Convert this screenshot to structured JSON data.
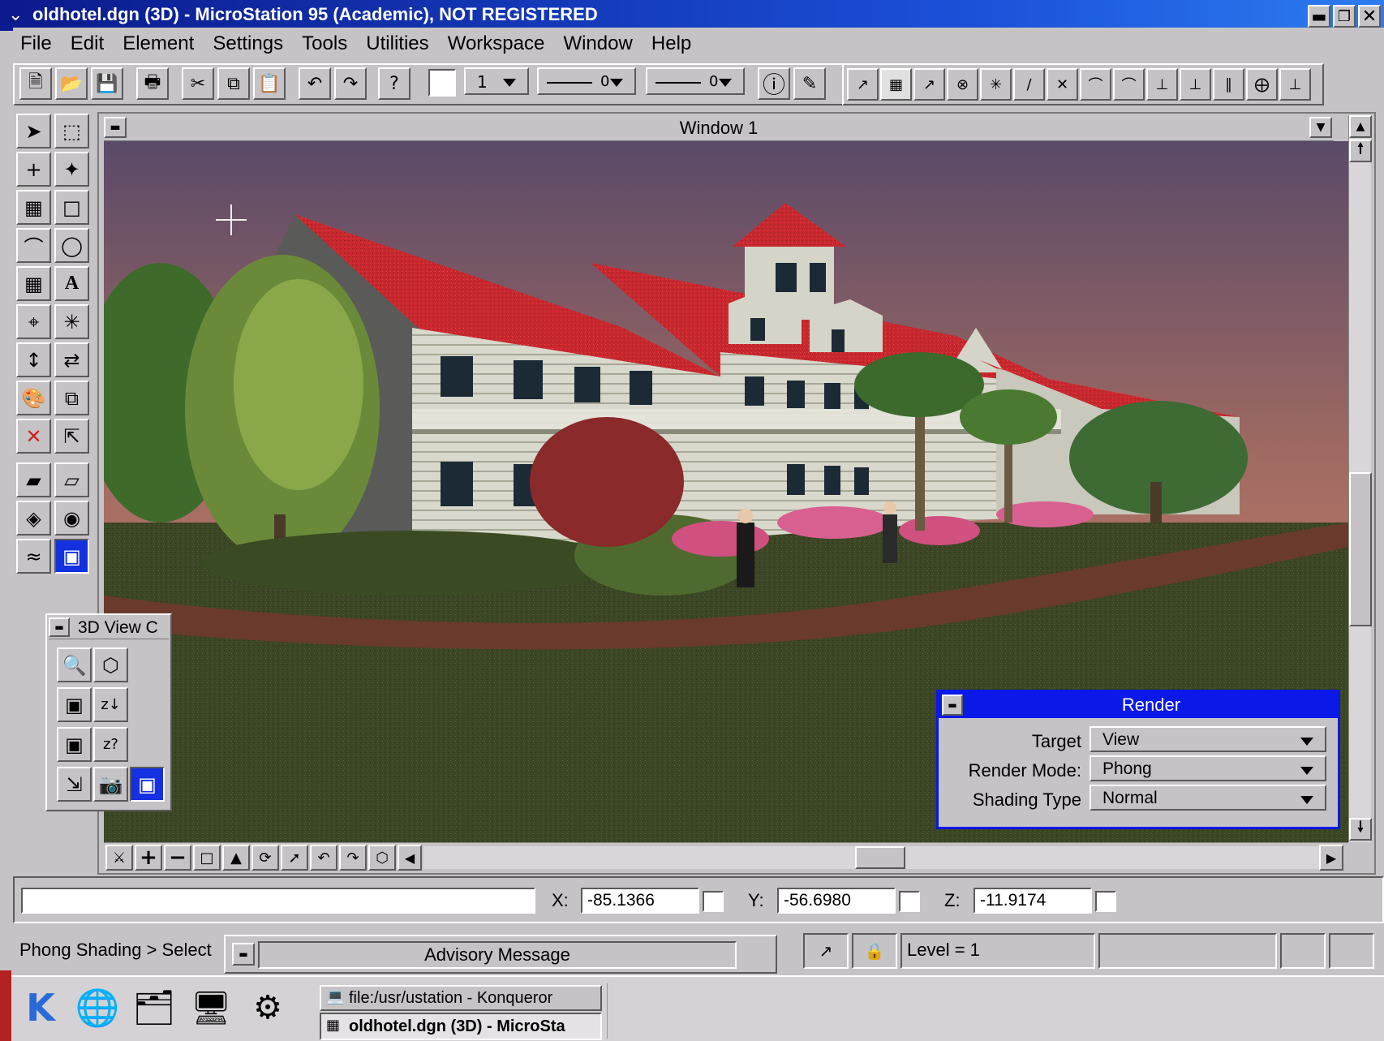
{
  "window": {
    "title": "oldhotel.dgn (3D) - MicroStation 95 (Academic), NOT REGISTERED",
    "controls": [
      "minimize-icon",
      "maximize-icon",
      "close-icon"
    ]
  },
  "menu": [
    "File",
    "Edit",
    "Element",
    "Settings",
    "Tools",
    "Utilities",
    "Workspace",
    "Window",
    "Help"
  ],
  "attributes": {
    "level": "1",
    "style_value": "0",
    "weight_value": "0"
  },
  "view_window": {
    "title": "Window 1"
  },
  "view_control_palette": {
    "title": "3D View C"
  },
  "render_dialog": {
    "title": "Render",
    "target_label": "Target",
    "target_value": "View",
    "mode_label": "Render Mode:",
    "mode_value": "Phong",
    "shading_label": "Shading Type",
    "shading_value": "Normal",
    "accent_color": "#0a18e8"
  },
  "coordinates": {
    "x_label": "X:",
    "x_value": "-85.1366",
    "y_label": "Y:",
    "y_value": "-56.6980",
    "z_label": "Z:",
    "z_value": "-11.9174"
  },
  "status": {
    "prompt": "Phong Shading > Select",
    "advisory": "Advisory Message",
    "level": "Level = 1"
  },
  "taskbar": {
    "tasks": [
      "file:/usr/ustation - Konqueror",
      "oldhotel.dgn (3D) - MicroSta"
    ]
  }
}
